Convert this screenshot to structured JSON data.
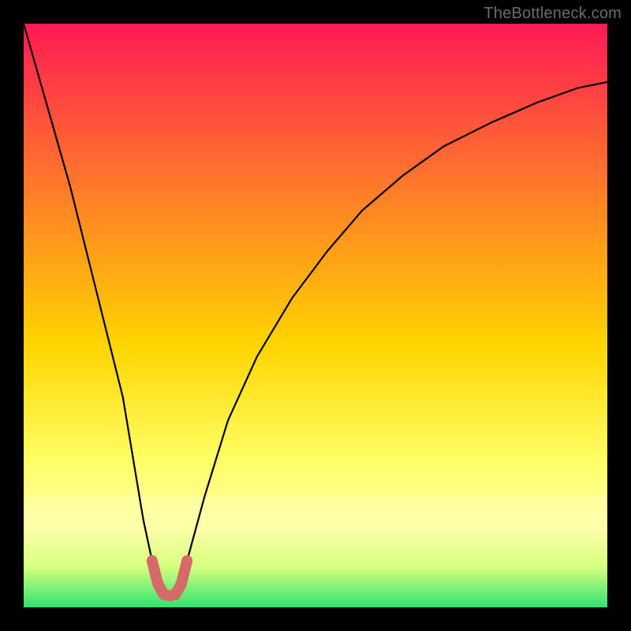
{
  "watermark": "TheBottleneck.com",
  "chart_data": {
    "type": "line",
    "title": "",
    "xlabel": "",
    "ylabel": "",
    "xlim": [
      0,
      100
    ],
    "ylim": [
      0,
      100
    ],
    "background_gradient": {
      "top": "#ff1a53",
      "mid1": "#ff7a2a",
      "mid2": "#ffd400",
      "mid3": "#ffff66",
      "band": "#ffffaa",
      "bottom": "#2fe36e"
    },
    "series": [
      {
        "name": "curve",
        "x": [
          0,
          4,
          8,
          11,
          14,
          17,
          19,
          20.5,
          22,
          23.5,
          25,
          26.5,
          28,
          31,
          35,
          40,
          46,
          52,
          58,
          65,
          72,
          80,
          88,
          95,
          100
        ],
        "values": [
          100,
          86,
          72,
          60,
          48,
          36,
          24,
          15,
          8,
          3.5,
          2,
          3.5,
          8,
          19,
          32,
          43,
          53,
          61,
          68,
          74,
          79,
          83,
          86.5,
          89,
          90
        ]
      }
    ],
    "highlight_segment": {
      "name": "trough",
      "color": "#d46a6a",
      "x": [
        22,
        23,
        24,
        25,
        26,
        27,
        28
      ],
      "values": [
        8,
        4,
        2.2,
        2,
        2.2,
        4,
        8
      ]
    }
  }
}
